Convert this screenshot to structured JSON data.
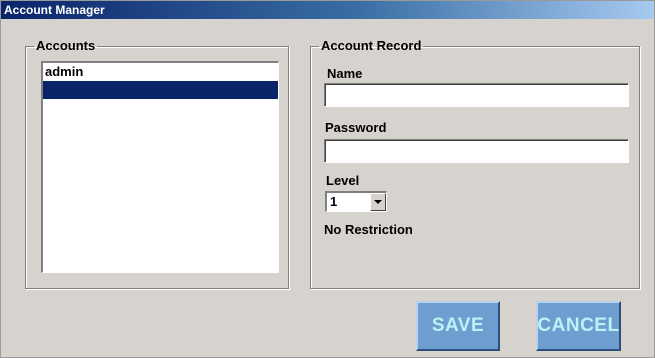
{
  "window": {
    "title": "Account Manager"
  },
  "accounts": {
    "legend": "Accounts",
    "items": [
      {
        "label": "admin",
        "selected": false
      },
      {
        "label": "",
        "selected": true
      }
    ]
  },
  "record": {
    "legend": "Account Record",
    "name_label": "Name",
    "name_value": "",
    "password_label": "Password",
    "password_value": "",
    "level_label": "Level",
    "level_value": "1",
    "level_description": "No Restriction"
  },
  "buttons": {
    "save_label": "SAVE",
    "cancel_label": "CANCEL"
  },
  "colors": {
    "selection": "#0a246a",
    "button_face": "#6e9ed0",
    "button_text": "#b9f3f7",
    "window_bg": "#d6d3ce"
  }
}
